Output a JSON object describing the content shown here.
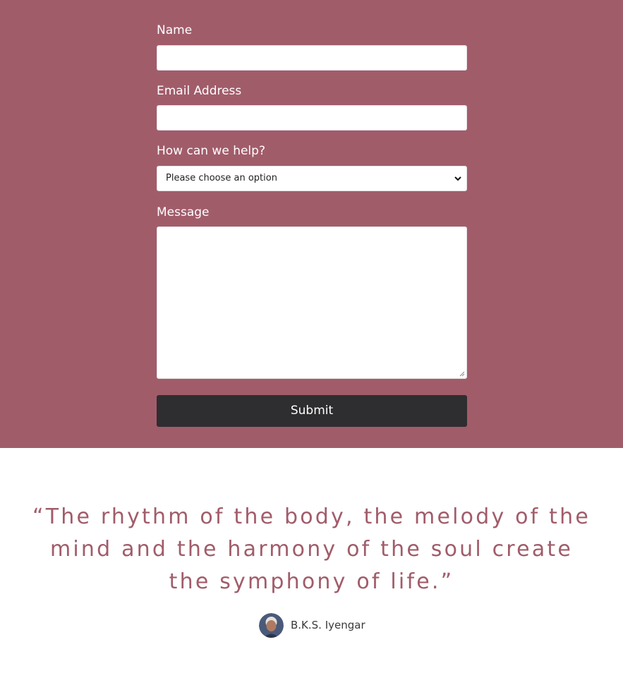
{
  "form": {
    "name_label": "Name",
    "name_value": "",
    "email_label": "Email Address",
    "email_value": "",
    "help_label": "How can we help?",
    "help_selected": "Please choose an option",
    "message_label": "Message",
    "message_value": "",
    "submit_label": "Submit"
  },
  "testimonial": {
    "quote": "“The rhythm of the body, the melody of the mind and the harmony of the soul create the symphony of life.”",
    "author": "B.K.S. Iyengar"
  },
  "colors": {
    "form_background": "#a15c6a",
    "submit_background": "#2e2d2f",
    "quote_text": "#a15c6a"
  }
}
